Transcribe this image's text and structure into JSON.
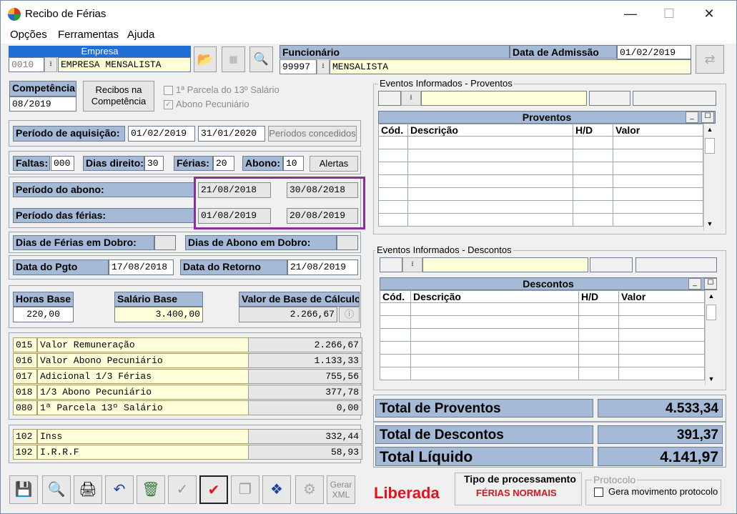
{
  "window": {
    "title": "Recibo de Férias",
    "minimize": "—",
    "maximize": "☐",
    "close": "✕"
  },
  "menu": [
    "Opções",
    "Ferramentas",
    "Ajuda"
  ],
  "empresa": {
    "label": "Empresa",
    "code": "0010",
    "name": "EMPRESA MENSALISTA"
  },
  "funcionario": {
    "label": "Funcionário",
    "code": "99997",
    "name": "MENSALISTA",
    "admissao_label": "Data de Admissão",
    "admissao": "01/02/2019"
  },
  "competencia": {
    "label": "Competência",
    "value": "08/2019",
    "recibos_label": "Recibos na Competência",
    "parcela13": "1ª Parcela do 13º Salário",
    "abono": "Abono Pecuniário"
  },
  "aquisicao": {
    "label": "Período de aquisição:",
    "inicio": "01/02/2019",
    "fim": "31/01/2020",
    "btn": "Períodos concedidos"
  },
  "dias": {
    "faltas_label": "Faltas:",
    "faltas": "000",
    "direito_label": "Dias direito:",
    "direito": "30",
    "ferias_label": "Férias:",
    "ferias": "20",
    "abono_label": "Abono:",
    "abono": "10",
    "alertas": "Alertas"
  },
  "periodo_abono": {
    "label": "Período do abono:",
    "inicio": "21/08/2018",
    "fim": "30/08/2018"
  },
  "periodo_ferias": {
    "label": "Período das férias:",
    "inicio": "01/08/2019",
    "fim": "20/08/2019"
  },
  "dobro": {
    "ferias_label": "Dias de Férias em Dobro:",
    "abono_label": "Dias de Abono em Dobro:"
  },
  "datas": {
    "pgto_label": "Data do Pgto",
    "pgto": "17/08/2018",
    "retorno_label": "Data do Retorno",
    "retorno": "21/08/2019"
  },
  "bases": {
    "horas_label": "Horas Base",
    "horas": "220,00",
    "salario_label": "Salário Base",
    "salario": "3.400,00",
    "calculo_label": "Valor de Base de Cálculo",
    "calculo": "2.266,67"
  },
  "proventos_calc": [
    {
      "code": "015",
      "desc": "Valor Remuneração",
      "value": "2.266,67"
    },
    {
      "code": "016",
      "desc": "Valor Abono Pecuniário",
      "value": "1.133,33"
    },
    {
      "code": "017",
      "desc": "Adicional 1/3 Férias",
      "value": "755,56"
    },
    {
      "code": "018",
      "desc": "1/3 Abono Pecuniário",
      "value": "377,78"
    },
    {
      "code": "080",
      "desc": "1ª Parcela 13º Salário",
      "value": "0,00"
    }
  ],
  "descontos_calc": [
    {
      "code": "102",
      "desc": "Inss",
      "value": "332,44"
    },
    {
      "code": "192",
      "desc": "I.R.R.F",
      "value": "58,93"
    }
  ],
  "eventos_proventos": {
    "group": "Eventos Informados - Proventos",
    "title": "Proventos",
    "cols": [
      "Cód.",
      "Descrição",
      "H/D",
      "Valor"
    ]
  },
  "eventos_descontos": {
    "group": "Eventos Informados - Descontos",
    "title": "Descontos",
    "cols": [
      "Cód.",
      "Descrição",
      "H/D",
      "Valor"
    ]
  },
  "totais": {
    "proventos_label": "Total de Proventos",
    "proventos": "4.533,34",
    "descontos_label": "Total de Descontos",
    "descontos": "391,37",
    "liquido_label": "Total Líquido",
    "liquido": "4.141,97"
  },
  "status": {
    "text": "Liberada",
    "color": "#e0141e"
  },
  "processamento": {
    "label": "Tipo de processamento",
    "value": "FÉRIAS NORMAIS"
  },
  "protocolo": {
    "label": "Protocolo",
    "check": "Gera movimento protocolo"
  },
  "toolbar": {
    "gerar_xml": "Gerar XML"
  }
}
